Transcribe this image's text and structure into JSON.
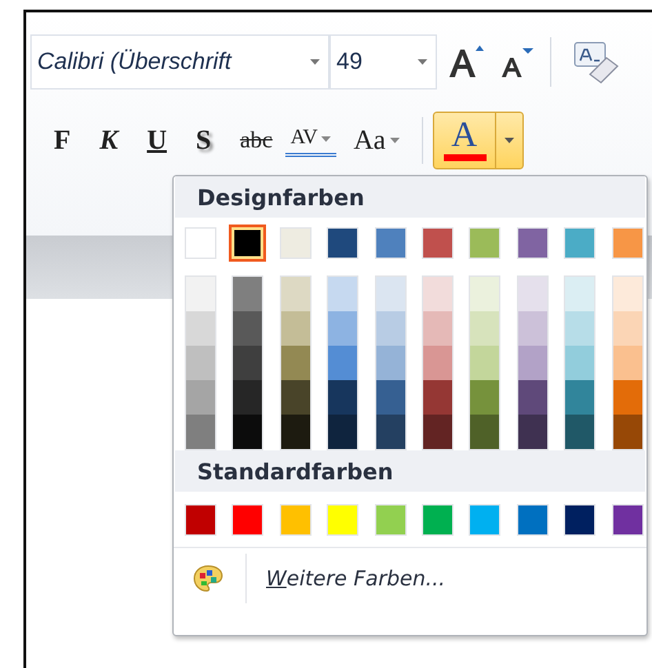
{
  "toolbar": {
    "font_name": "Calibri (Überschrift",
    "font_size": "49",
    "format_buttons": [
      {
        "label": "F",
        "kind": "bold"
      },
      {
        "label": "K",
        "kind": "italic"
      },
      {
        "label": "U",
        "kind": "underline"
      },
      {
        "label": "S",
        "kind": "shadow"
      },
      {
        "label": "abc",
        "kind": "strike"
      },
      {
        "label": "AV",
        "kind": "spacing"
      },
      {
        "label": "Aa",
        "kind": "case"
      }
    ],
    "font_color_button": {
      "label": "A",
      "color": "#ff0000",
      "pressed": true
    }
  },
  "color_menu": {
    "theme_heading": "Designfarben",
    "theme_colors": [
      {
        "color": "#ffffff",
        "selected": false,
        "shades": [
          {
            "color": "#f2f2f2"
          },
          {
            "color": "#d8d8d8"
          },
          {
            "color": "#bfbfbf"
          },
          {
            "color": "#a5a5a5"
          },
          {
            "color": "#7f7f7f"
          }
        ]
      },
      {
        "color": "#000000",
        "selected": true,
        "shades": [
          {
            "color": "#7f7f7f"
          },
          {
            "color": "#595959"
          },
          {
            "color": "#3f3f3f"
          },
          {
            "color": "#262626"
          },
          {
            "color": "#0c0c0c"
          }
        ]
      },
      {
        "color": "#eeece1",
        "selected": false,
        "shades": [
          {
            "color": "#ddd9c3"
          },
          {
            "color": "#c4bd97"
          },
          {
            "color": "#938953"
          },
          {
            "color": "#494429"
          },
          {
            "color": "#1d1b10"
          }
        ]
      },
      {
        "color": "#1f497d",
        "selected": false,
        "shades": [
          {
            "color": "#c6d9f0"
          },
          {
            "color": "#8db3e2"
          },
          {
            "color": "#548dd4"
          },
          {
            "color": "#17365d"
          },
          {
            "color": "#0f243e"
          }
        ]
      },
      {
        "color": "#4f81bd",
        "selected": false,
        "shades": [
          {
            "color": "#dbe5f1"
          },
          {
            "color": "#b8cce4"
          },
          {
            "color": "#95b3d7"
          },
          {
            "color": "#366092"
          },
          {
            "color": "#244061"
          }
        ]
      },
      {
        "color": "#c0504d",
        "selected": false,
        "shades": [
          {
            "color": "#f2dcdb"
          },
          {
            "color": "#e5b9b7"
          },
          {
            "color": "#d99694"
          },
          {
            "color": "#953734"
          },
          {
            "color": "#632423"
          }
        ]
      },
      {
        "color": "#9bbb59",
        "selected": false,
        "shades": [
          {
            "color": "#ebf1dd"
          },
          {
            "color": "#d7e3bc"
          },
          {
            "color": "#c3d69b"
          },
          {
            "color": "#76923c"
          },
          {
            "color": "#4f6128"
          }
        ]
      },
      {
        "color": "#8064a2",
        "selected": false,
        "shades": [
          {
            "color": "#e5e0ec"
          },
          {
            "color": "#ccc1d9"
          },
          {
            "color": "#b2a2c7"
          },
          {
            "color": "#5f497a"
          },
          {
            "color": "#3f3151"
          }
        ]
      },
      {
        "color": "#4bacc6",
        "selected": false,
        "shades": [
          {
            "color": "#dbeef3"
          },
          {
            "color": "#b7dde8"
          },
          {
            "color": "#92cddc"
          },
          {
            "color": "#31859b"
          },
          {
            "color": "#205867"
          }
        ]
      },
      {
        "color": "#f79646",
        "selected": false,
        "shades": [
          {
            "color": "#fdeada"
          },
          {
            "color": "#fbd5b5"
          },
          {
            "color": "#fac08f"
          },
          {
            "color": "#e36c09"
          },
          {
            "color": "#974806"
          }
        ]
      }
    ],
    "standard_heading": "Standardfarben",
    "standard_colors": [
      {
        "color": "#c00000"
      },
      {
        "color": "#ff0000"
      },
      {
        "color": "#ffc000"
      },
      {
        "color": "#ffff00"
      },
      {
        "color": "#92d050"
      },
      {
        "color": "#00b050"
      },
      {
        "color": "#00b0f0"
      },
      {
        "color": "#0070c0"
      },
      {
        "color": "#002060"
      },
      {
        "color": "#7030a0"
      }
    ],
    "more_colors": "Weitere Farben..."
  }
}
